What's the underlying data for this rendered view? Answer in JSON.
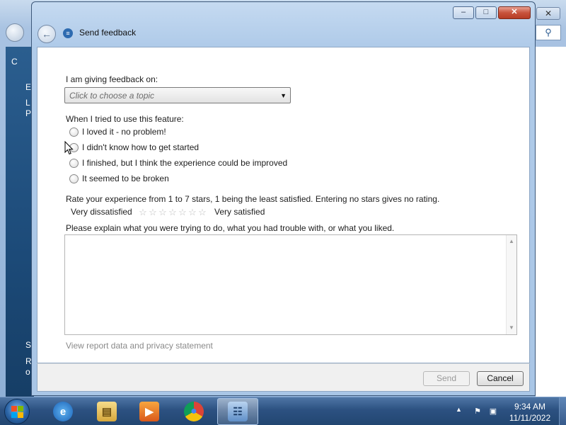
{
  "dialog": {
    "title": "Send feedback",
    "titlebar": {
      "minimize": "–",
      "maximize": "□",
      "close": "✕"
    }
  },
  "form": {
    "topic_label": "I am giving feedback on:",
    "topic_placeholder": "Click to choose a topic",
    "feature_label": "When I tried to use this feature:",
    "options": [
      {
        "label": "I loved it - no problem!"
      },
      {
        "label": "I didn't know how to get started"
      },
      {
        "label": "I finished, but I think the experience could be improved"
      },
      {
        "label": "It seemed to be broken"
      }
    ],
    "rating_label": "Rate your experience from 1 to 7 stars, 1 being the least satisfied.  Entering no stars gives no rating.",
    "rating_low": "Very dissatisfied",
    "rating_high": "Very satisfied",
    "rating_value": 0,
    "explain_label": "Please explain what you were trying to do, what you had trouble with, or what you liked.",
    "privacy_link": "View report data and privacy statement"
  },
  "buttons": {
    "send": "Send",
    "cancel": "Cancel"
  },
  "background_window": {
    "sidebar_letters": [
      "C",
      "E",
      "L",
      "P",
      "S",
      "R",
      "o"
    ]
  },
  "taskbar": {
    "apps": [
      {
        "name": "internet-explorer",
        "glyph": "e"
      },
      {
        "name": "windows-explorer",
        "glyph": "▤"
      },
      {
        "name": "media-player",
        "glyph": "▶"
      },
      {
        "name": "chrome",
        "glyph": "●"
      },
      {
        "name": "control-panel",
        "glyph": "☷"
      }
    ],
    "time": "9:34 AM",
    "date": "11/11/2022"
  },
  "colors": {
    "accent": "#2c5181",
    "close_button": "#c8533c"
  }
}
